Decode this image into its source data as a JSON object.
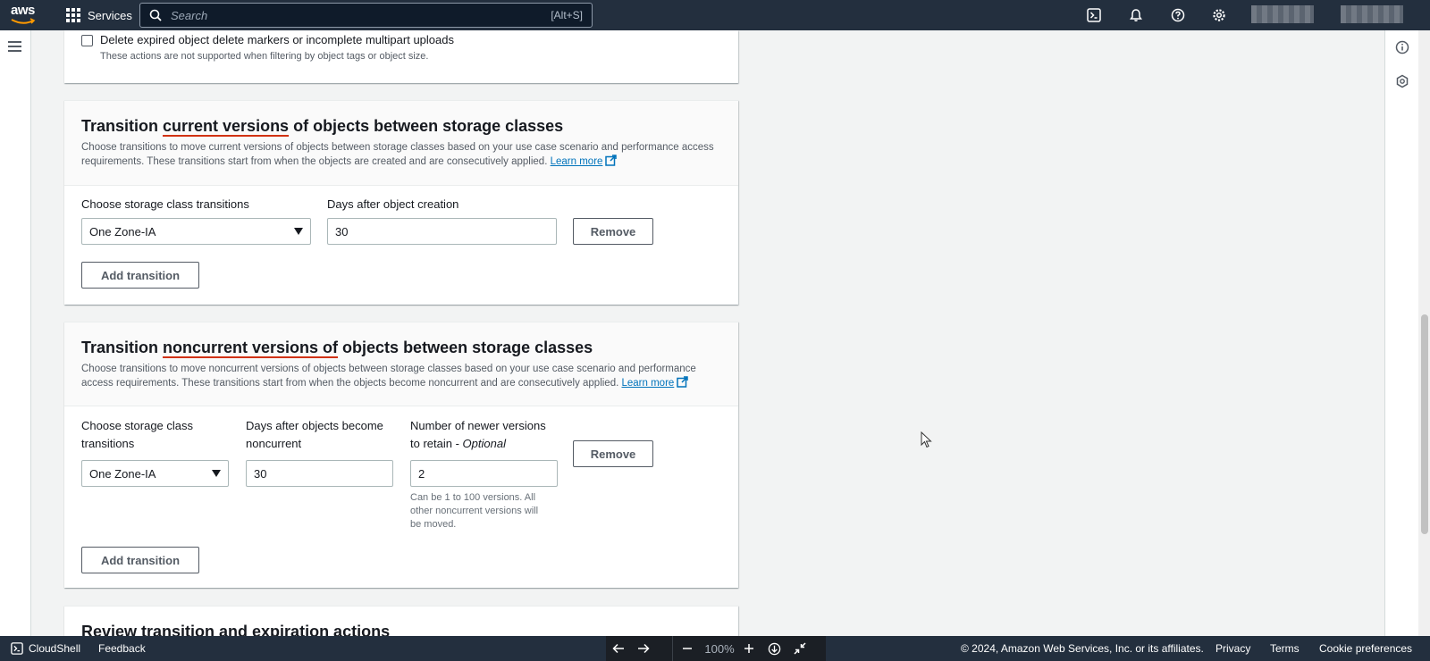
{
  "topnav": {
    "logo_text": "aws",
    "services_label": "Services",
    "search_placeholder": "Search",
    "search_shortcut": "[Alt+S]",
    "icons": [
      "cloudshell-icon",
      "bell-icon",
      "help-icon",
      "gear-icon"
    ]
  },
  "expiration_option": {
    "checkbox_label": "Delete expired object delete markers or incomplete multipart uploads",
    "checkbox_note": "These actions are not supported when filtering by object tags or object size.",
    "checked": false
  },
  "current_versions": {
    "title_pre": "Transition ",
    "title_mark": "current versions",
    "title_post": " of objects between storage classes",
    "description": "Choose transitions to move current versions of objects between storage classes based on your use case scenario and performance access requirements. These transitions start from when the objects are created and are consecutively applied.",
    "learn_more": "Learn more",
    "storage_class_label": "Choose storage class transitions",
    "storage_class_value": "One Zone-IA",
    "days_label": "Days after object creation",
    "days_value": "30",
    "remove_label": "Remove",
    "add_label": "Add transition"
  },
  "noncurrent_versions": {
    "title_pre": "Transition ",
    "title_mark": "noncurrent versions of",
    "title_post": " objects between storage classes",
    "description": "Choose transitions to move noncurrent versions of objects between storage classes based on your use case scenario and performance access requirements. These transitions start from when the objects become noncurrent and are consecutively applied.",
    "learn_more": "Learn more",
    "storage_class_label_1": "Choose storage class",
    "storage_class_label_2": "transitions",
    "storage_class_value": "One Zone-IA",
    "days_label_1": "Days after objects become",
    "days_label_2": "noncurrent",
    "days_value": "30",
    "versions_label_1": "Number of newer versions",
    "versions_label_2": "to retain - ",
    "versions_label_optional": "Optional",
    "versions_value": "2",
    "versions_hint_1": "Can be 1 to 100 versions. All",
    "versions_hint_2": "other noncurrent versions will",
    "versions_hint_3": "be moved.",
    "remove_label": "Remove",
    "add_label": "Add transition"
  },
  "review": {
    "title": "Review transition and expiration actions"
  },
  "footer": {
    "cloudshell": "CloudShell",
    "feedback": "Feedback",
    "zoom": "100%",
    "copyright": "© 2024, Amazon Web Services, Inc. or its affiliates.",
    "privacy": "Privacy",
    "terms": "Terms",
    "cookie": "Cookie preferences"
  }
}
